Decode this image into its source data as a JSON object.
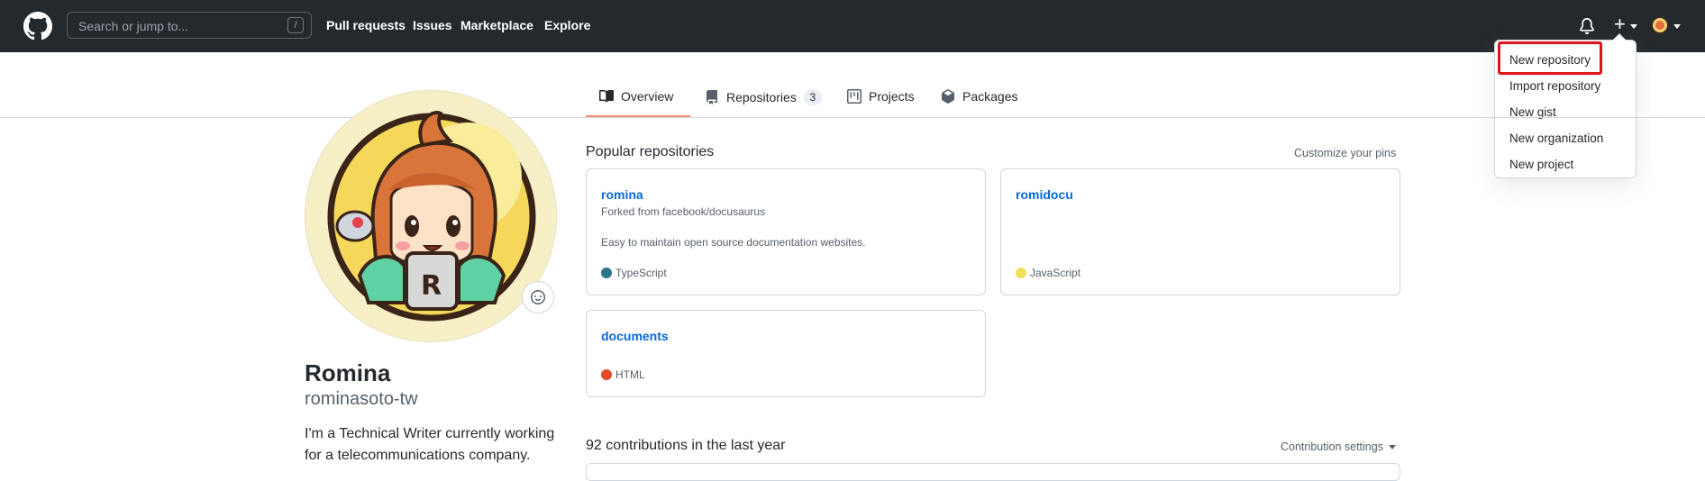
{
  "header": {
    "search_placeholder": "Search or jump to...",
    "search_shortcut": "/",
    "nav": [
      "Pull requests",
      "Issues",
      "Marketplace",
      "Explore"
    ]
  },
  "dropdown": {
    "items": [
      "New repository",
      "Import repository",
      "New gist",
      "New organization",
      "New project"
    ]
  },
  "tabs": [
    {
      "label": "Overview",
      "active": true
    },
    {
      "label": "Repositories",
      "count": "3"
    },
    {
      "label": "Projects"
    },
    {
      "label": "Packages"
    }
  ],
  "profile": {
    "name": "Romina",
    "login": "rominasoto-tw",
    "bio": "I'm a Technical Writer currently working for a telecommunications company."
  },
  "popular": {
    "title": "Popular repositories",
    "customize": "Customize your pins",
    "repos": [
      {
        "name": "romina",
        "fork": "Forked from facebook/docusaurus",
        "description": "Easy to maintain open source documentation websites.",
        "language": "TypeScript",
        "color": "#3178c6"
      },
      {
        "name": "romidocu",
        "fork": "",
        "description": "",
        "language": "JavaScript",
        "color": "#f1e05a"
      },
      {
        "name": "documents",
        "fork": "",
        "description": "",
        "language": "HTML",
        "color": "#e34c26"
      }
    ]
  },
  "contributions": {
    "text": "92 contributions in the last year",
    "settings": "Contribution settings"
  },
  "colors": {
    "header_bg": "#24292e",
    "link": "#0969da",
    "highlight_box": "#e1141b",
    "active_tab": "#fd8c73"
  }
}
